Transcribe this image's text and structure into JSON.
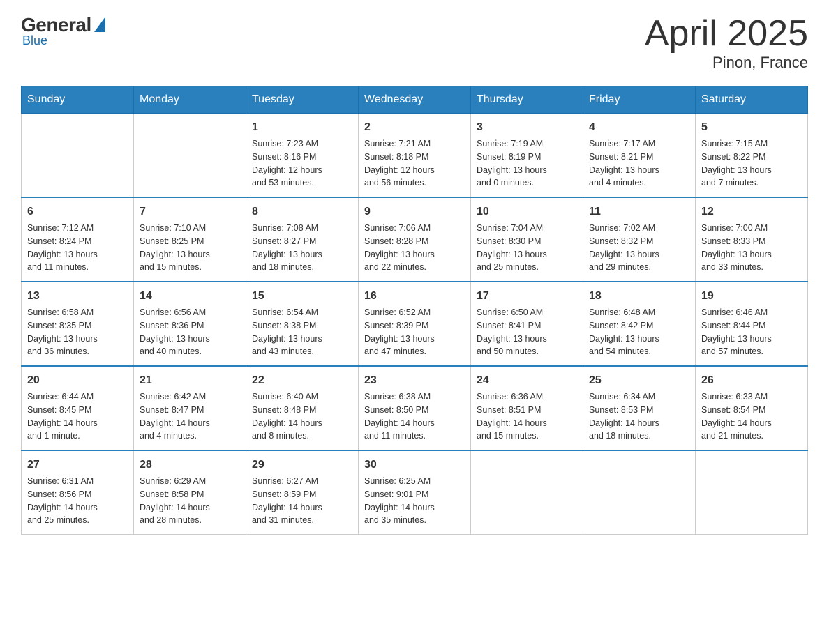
{
  "logo": {
    "general": "General",
    "blue": "Blue"
  },
  "header": {
    "title": "April 2025",
    "subtitle": "Pinon, France"
  },
  "weekdays": [
    "Sunday",
    "Monday",
    "Tuesday",
    "Wednesday",
    "Thursday",
    "Friday",
    "Saturday"
  ],
  "weeks": [
    [
      {
        "day": "",
        "info": ""
      },
      {
        "day": "",
        "info": ""
      },
      {
        "day": "1",
        "info": "Sunrise: 7:23 AM\nSunset: 8:16 PM\nDaylight: 12 hours\nand 53 minutes."
      },
      {
        "day": "2",
        "info": "Sunrise: 7:21 AM\nSunset: 8:18 PM\nDaylight: 12 hours\nand 56 minutes."
      },
      {
        "day": "3",
        "info": "Sunrise: 7:19 AM\nSunset: 8:19 PM\nDaylight: 13 hours\nand 0 minutes."
      },
      {
        "day": "4",
        "info": "Sunrise: 7:17 AM\nSunset: 8:21 PM\nDaylight: 13 hours\nand 4 minutes."
      },
      {
        "day": "5",
        "info": "Sunrise: 7:15 AM\nSunset: 8:22 PM\nDaylight: 13 hours\nand 7 minutes."
      }
    ],
    [
      {
        "day": "6",
        "info": "Sunrise: 7:12 AM\nSunset: 8:24 PM\nDaylight: 13 hours\nand 11 minutes."
      },
      {
        "day": "7",
        "info": "Sunrise: 7:10 AM\nSunset: 8:25 PM\nDaylight: 13 hours\nand 15 minutes."
      },
      {
        "day": "8",
        "info": "Sunrise: 7:08 AM\nSunset: 8:27 PM\nDaylight: 13 hours\nand 18 minutes."
      },
      {
        "day": "9",
        "info": "Sunrise: 7:06 AM\nSunset: 8:28 PM\nDaylight: 13 hours\nand 22 minutes."
      },
      {
        "day": "10",
        "info": "Sunrise: 7:04 AM\nSunset: 8:30 PM\nDaylight: 13 hours\nand 25 minutes."
      },
      {
        "day": "11",
        "info": "Sunrise: 7:02 AM\nSunset: 8:32 PM\nDaylight: 13 hours\nand 29 minutes."
      },
      {
        "day": "12",
        "info": "Sunrise: 7:00 AM\nSunset: 8:33 PM\nDaylight: 13 hours\nand 33 minutes."
      }
    ],
    [
      {
        "day": "13",
        "info": "Sunrise: 6:58 AM\nSunset: 8:35 PM\nDaylight: 13 hours\nand 36 minutes."
      },
      {
        "day": "14",
        "info": "Sunrise: 6:56 AM\nSunset: 8:36 PM\nDaylight: 13 hours\nand 40 minutes."
      },
      {
        "day": "15",
        "info": "Sunrise: 6:54 AM\nSunset: 8:38 PM\nDaylight: 13 hours\nand 43 minutes."
      },
      {
        "day": "16",
        "info": "Sunrise: 6:52 AM\nSunset: 8:39 PM\nDaylight: 13 hours\nand 47 minutes."
      },
      {
        "day": "17",
        "info": "Sunrise: 6:50 AM\nSunset: 8:41 PM\nDaylight: 13 hours\nand 50 minutes."
      },
      {
        "day": "18",
        "info": "Sunrise: 6:48 AM\nSunset: 8:42 PM\nDaylight: 13 hours\nand 54 minutes."
      },
      {
        "day": "19",
        "info": "Sunrise: 6:46 AM\nSunset: 8:44 PM\nDaylight: 13 hours\nand 57 minutes."
      }
    ],
    [
      {
        "day": "20",
        "info": "Sunrise: 6:44 AM\nSunset: 8:45 PM\nDaylight: 14 hours\nand 1 minute."
      },
      {
        "day": "21",
        "info": "Sunrise: 6:42 AM\nSunset: 8:47 PM\nDaylight: 14 hours\nand 4 minutes."
      },
      {
        "day": "22",
        "info": "Sunrise: 6:40 AM\nSunset: 8:48 PM\nDaylight: 14 hours\nand 8 minutes."
      },
      {
        "day": "23",
        "info": "Sunrise: 6:38 AM\nSunset: 8:50 PM\nDaylight: 14 hours\nand 11 minutes."
      },
      {
        "day": "24",
        "info": "Sunrise: 6:36 AM\nSunset: 8:51 PM\nDaylight: 14 hours\nand 15 minutes."
      },
      {
        "day": "25",
        "info": "Sunrise: 6:34 AM\nSunset: 8:53 PM\nDaylight: 14 hours\nand 18 minutes."
      },
      {
        "day": "26",
        "info": "Sunrise: 6:33 AM\nSunset: 8:54 PM\nDaylight: 14 hours\nand 21 minutes."
      }
    ],
    [
      {
        "day": "27",
        "info": "Sunrise: 6:31 AM\nSunset: 8:56 PM\nDaylight: 14 hours\nand 25 minutes."
      },
      {
        "day": "28",
        "info": "Sunrise: 6:29 AM\nSunset: 8:58 PM\nDaylight: 14 hours\nand 28 minutes."
      },
      {
        "day": "29",
        "info": "Sunrise: 6:27 AM\nSunset: 8:59 PM\nDaylight: 14 hours\nand 31 minutes."
      },
      {
        "day": "30",
        "info": "Sunrise: 6:25 AM\nSunset: 9:01 PM\nDaylight: 14 hours\nand 35 minutes."
      },
      {
        "day": "",
        "info": ""
      },
      {
        "day": "",
        "info": ""
      },
      {
        "day": "",
        "info": ""
      }
    ]
  ]
}
